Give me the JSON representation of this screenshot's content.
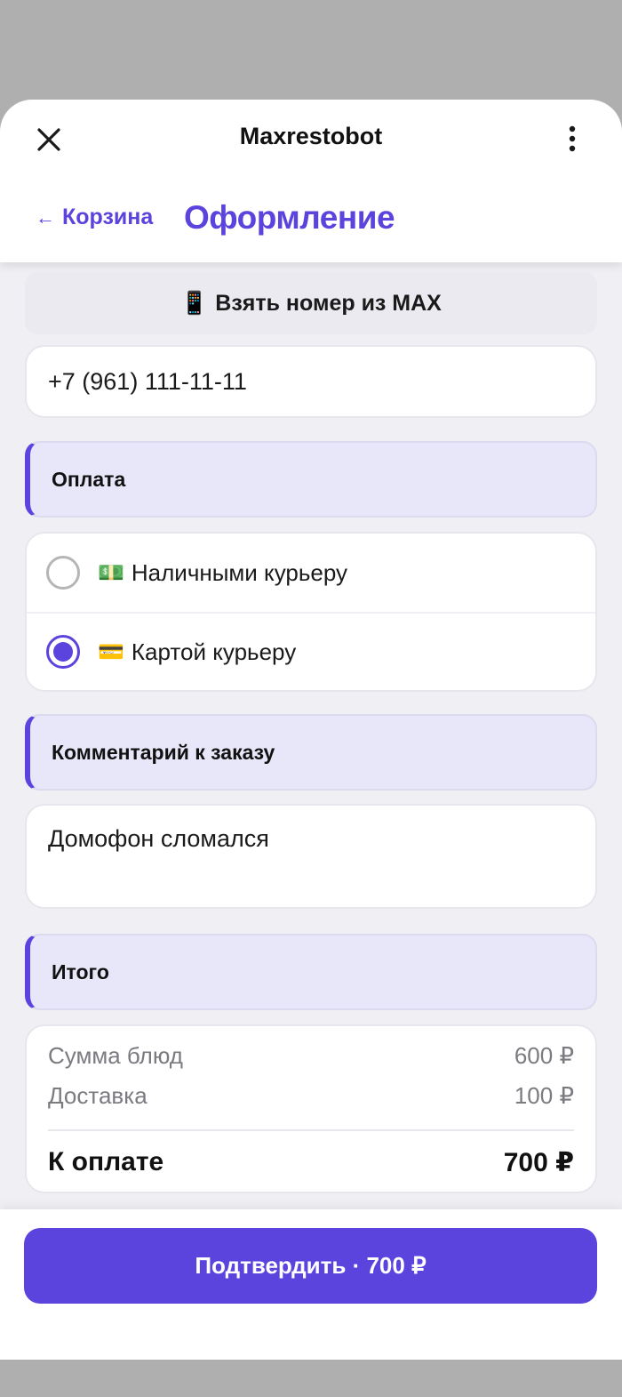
{
  "header": {
    "app_title": "Maxrestobot",
    "back_label": "Корзина",
    "back_arrow": "←",
    "page_title": "Оформление"
  },
  "contact": {
    "from_max_emoji": "📱",
    "from_max_label": "Взять номер из MAX",
    "phone_value": "+7 (961) 111-11-11"
  },
  "payment": {
    "section_title": "Оплата",
    "options": [
      {
        "emoji": "💵",
        "label": "Наличными курьеру",
        "selected": false
      },
      {
        "emoji": "💳",
        "label": "Картой курьеру",
        "selected": true
      }
    ]
  },
  "comment": {
    "section_title": "Комментарий к заказу",
    "value": "Домофон сломался"
  },
  "summary": {
    "section_title": "Итого",
    "dishes_label": "Сумма блюд",
    "dishes_value": "600 ₽",
    "delivery_label": "Доставка",
    "delivery_value": "100 ₽",
    "total_label": "К оплате",
    "total_value": "700 ₽"
  },
  "footer": {
    "confirm_label": "Подтвердить · 700 ₽"
  },
  "colors": {
    "accent": "#5b43dd",
    "section_bg": "#e8e6f9",
    "page_bg": "#f0f0f4"
  }
}
